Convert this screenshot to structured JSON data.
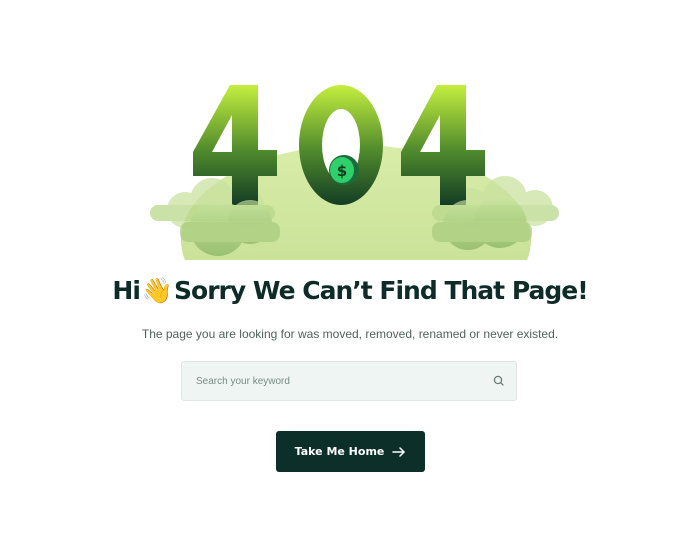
{
  "illustration": {
    "digits": [
      "4",
      "0",
      "4"
    ],
    "coin_symbol": "$",
    "colors": {
      "digit_top": "#c4ef3f",
      "digit_bottom": "#143d25",
      "cloud": "#a9cf6f",
      "coin": "#2fcf6a"
    }
  },
  "heading": {
    "before": "Hi",
    "emoji": "👋",
    "after": "Sorry We Can’t Find That Page!"
  },
  "subtitle": "The page you are looking for was moved, removed, renamed or never existed.",
  "search": {
    "value": "",
    "placeholder": "Search your keyword",
    "icon": "search-icon"
  },
  "home_button": {
    "label": "Take Me Home",
    "icon": "arrow-right-icon"
  },
  "colors": {
    "heading": "#0d2b27",
    "button_bg": "#0c2f29",
    "search_bg": "#eff5f3"
  }
}
